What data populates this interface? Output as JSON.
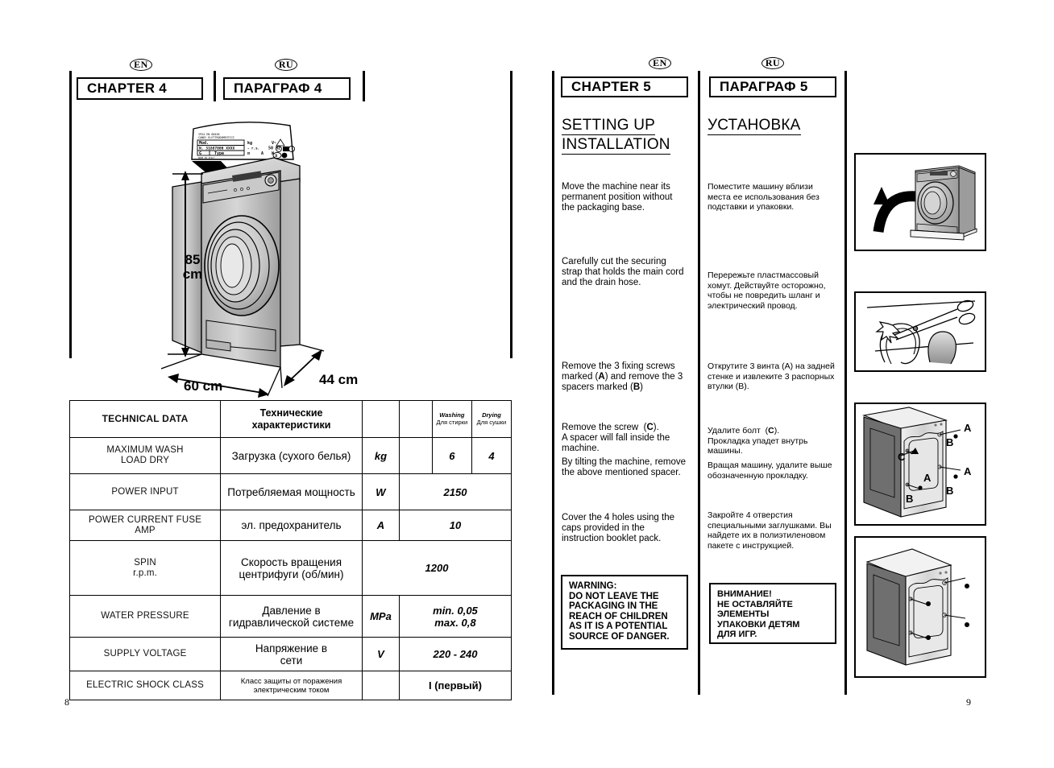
{
  "left_page": {
    "number": "8",
    "badges": {
      "en": "EN",
      "ru": "RU"
    },
    "chapter_en": "CHAPTER 4",
    "chapter_ru": "ПАРАГРАФ 4",
    "rating_plate": {
      "mod_label": "Mod.",
      "n_label": "N.",
      "serial": "31887800 XXXX",
      "g_label": "G",
      "type_label": "Type",
      "kg_label": "kg",
      "hz_label": "50 Hz",
      "a_label": "A",
      "w_label": "W",
      "v_label": "V~",
      "d_label": "D"
    },
    "dimensions": {
      "height": "85\ncm",
      "height_line1": "85",
      "height_line2": "cm",
      "width": "60 cm",
      "depth": "44 cm"
    },
    "table": {
      "header": {
        "en": "TECHNICAL DATA",
        "ru": "Технические характеристики",
        "unit": "",
        "gap": "",
        "washing_en": "Washing",
        "washing_ru": "Для стирки",
        "drying_en": "Drying",
        "drying_ru": "Для сушки"
      },
      "rows": [
        {
          "en": "MAXIMUM WASH\nLOAD DRY",
          "en_l1": "MAXIMUM WASH",
          "en_l2": "LOAD DRY",
          "ru": "Загрузка (сухого белья)",
          "unit": "kg",
          "washing": "6",
          "drying": "4"
        },
        {
          "en": "POWER INPUT",
          "en_l1": "POWER INPUT",
          "en_l2": "",
          "ru": "Потребляемая мощность",
          "unit": "W",
          "value": "2150"
        },
        {
          "en": "POWER CURRENT FUSE\nAMP",
          "en_l1": "POWER CURRENT FUSE",
          "en_l2": "AMP",
          "ru": "эл. предохранитель",
          "unit": "A",
          "value": "10"
        },
        {
          "en": "SPIN\nr.p.m.",
          "en_l1": "SPIN",
          "en_l2": "r.p.m.",
          "ru_l1": "Скорость вращения",
          "ru_l2": "центрифуги (об/мин)",
          "unit": "",
          "value": "1200"
        },
        {
          "en": "WATER PRESSURE",
          "en_l1": "WATER PRESSURE",
          "en_l2": "",
          "ru_l1": "Давление в",
          "ru_l2": "гидравлической системе",
          "unit": "MPa",
          "value_l1": "min. 0,05",
          "value_l2": "max. 0,8"
        },
        {
          "en": "SUPPLY VOLTAGE",
          "en_l1": "SUPPLY VOLTAGE",
          "en_l2": "",
          "ru_l1": "Напряжение в",
          "ru_l2": "сети",
          "unit": "V",
          "value": "220 - 240"
        },
        {
          "en": "ELECTRIC SHOCK CLASS",
          "en_l1": "ELECTRIC SHOCK CLASS",
          "en_l2": "",
          "ru_l1": "Класс защиты от поражения",
          "ru_l2": "электрическим током",
          "unit": "",
          "value": "I (первый)"
        }
      ]
    }
  },
  "right_page": {
    "number": "9",
    "badges": {
      "en": "EN",
      "ru": "RU"
    },
    "chapter_en": "CHAPTER 5",
    "chapter_ru": "ПАРАГРАФ 5",
    "title_en_l1": "SETTING UP",
    "title_en_l2": "INSTALLATION",
    "title_ru": "УСТАНОВКА",
    "en_paragraphs": [
      "Move the machine near its permanent position without the packaging base.",
      "Carefully cut the securing strap that holds the main cord and the drain hose.",
      "Remove the 3 fixing screws marked (A) and remove the 3 spacers marked (B)",
      "Remove the screw  (C).\nA spacer will fall inside the machine.",
      "By tilting the machine, remove the above mentioned spacer.",
      "Cover the 4 holes using the caps provided in the instruction booklet pack."
    ],
    "ru_paragraphs": [
      "Поместите машину вблизи места ее использования без подставки и упаковки.",
      "Перережьте пластмассовый хомут. Действуйте осторожно, чтобы не повредить шланг и электрический провод.",
      "Открутите 3 винта (А) на задней стенке и извлеките 3 распорных втулки (В).",
      "Удалите болт  (С).\nПрокладка упадет внутрь машины.",
      "Вращая машину, удалите выше обозначенную прокладку.",
      "Закройте 4 отверстия специальными заглушками. Вы найдете их в полиэтиленовом пакете с инструкцией."
    ],
    "warning_en": "WARNING:\nDO NOT LEAVE THE\nPACKAGING IN THE\nREACH OF CHILDREN\nAS IT IS A POTENTIAL\nSOURCE OF DANGER.",
    "warning_ru": "ВНИМАНИЕ!\nНЕ ОСТАВЛЯЙТЕ\nЭЛЕМЕНТЫ\nУПАКОВКИ ДЕТЯМ\nДЛЯ ИГР.",
    "illustrations": {
      "panel1_name": "machine-removed-from-base",
      "panel2_name": "cutting-strap-with-scissors",
      "panel3_labels": [
        "A",
        "B",
        "C",
        "A",
        "B",
        "A",
        "B"
      ],
      "panel4_name": "rear-holes-with-caps"
    }
  },
  "colors": {
    "ink": "#000000",
    "paper": "#ffffff",
    "machine_light": "#d9d9d9",
    "machine_mid": "#a8a8a8",
    "machine_dark": "#6e6e6e"
  }
}
